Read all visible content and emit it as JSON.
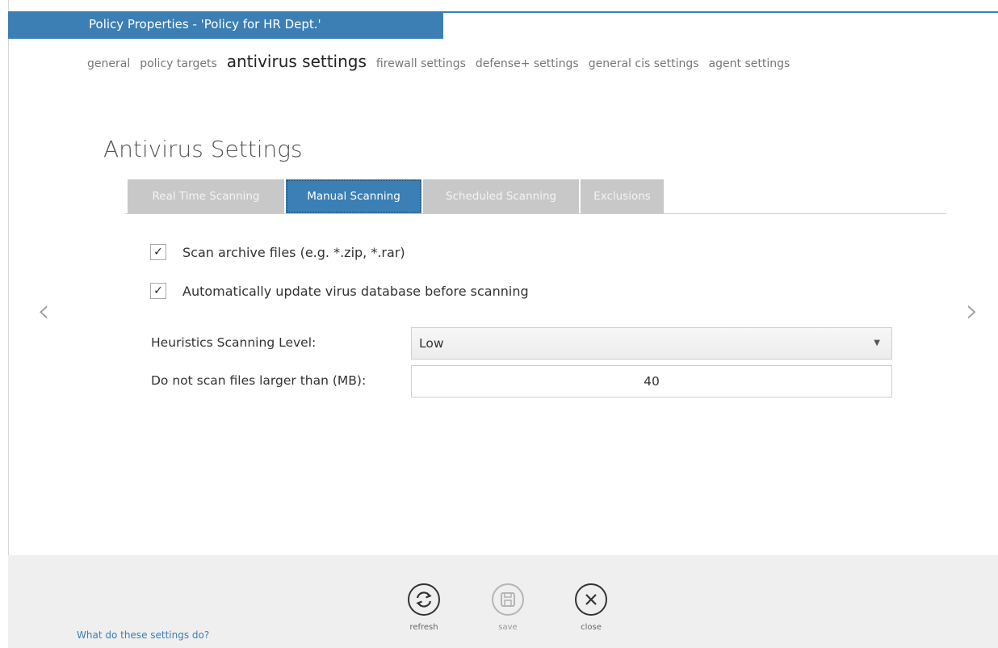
{
  "window": {
    "title": "Policy Properties - 'Policy for HR Dept.'"
  },
  "nav": [
    {
      "label": "general"
    },
    {
      "label": "policy targets"
    },
    {
      "label": "antivirus settings"
    },
    {
      "label": "firewall settings"
    },
    {
      "label": "defense+ settings"
    },
    {
      "label": "general cis settings"
    },
    {
      "label": "agent settings"
    }
  ],
  "section": {
    "title": "Antivirus Settings"
  },
  "tabs": [
    {
      "label": "Real Time Scanning"
    },
    {
      "label": "Manual Scanning"
    },
    {
      "label": "Scheduled Scanning"
    },
    {
      "label": "Exclusions"
    }
  ],
  "options": {
    "scan_archive": {
      "label": "Scan archive files (e.g. *.zip, *.rar)",
      "checked": true,
      "mark": "✓"
    },
    "auto_update": {
      "label": "Automatically update virus database before scanning",
      "checked": true,
      "mark": "✓"
    }
  },
  "fields": {
    "heuristics": {
      "label": "Heuristics Scanning Level:",
      "value": "Low"
    },
    "max_size": {
      "label": "Do not scan files larger than (MB):",
      "value": "40"
    }
  },
  "nav_arrows": {
    "prev": "‹",
    "next": "›"
  },
  "footer": {
    "help_link": "What do these settings do?",
    "refresh_label": "refresh",
    "save_label": "save",
    "close_label": "close"
  },
  "colors": {
    "accent": "#3b7fb5",
    "tab_inactive": "#c8c8c8",
    "footer_bg": "#efefef"
  }
}
